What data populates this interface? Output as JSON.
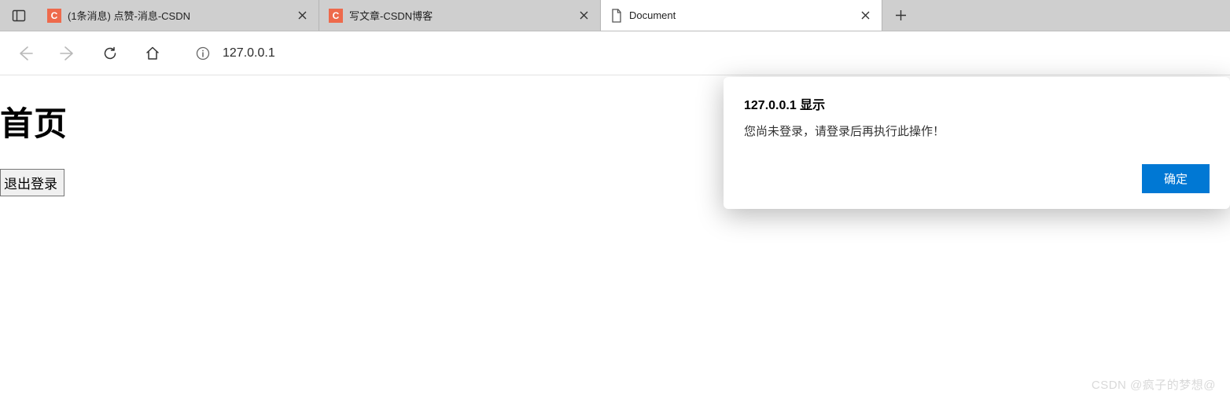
{
  "tabs": [
    {
      "title": "(1条消息) 点赞-消息-CSDN",
      "favicon": "csdn",
      "favicon_letter": "C"
    },
    {
      "title": "写文章-CSDN博客",
      "favicon": "csdn",
      "favicon_letter": "C"
    },
    {
      "title": "Document",
      "favicon": "file"
    }
  ],
  "address_bar": {
    "url": "127.0.0.1"
  },
  "page": {
    "heading": "首页",
    "logout_label": "退出登录"
  },
  "alert": {
    "title": "127.0.0.1 显示",
    "message": "您尚未登录，请登录后再执行此操作！",
    "ok_label": "确定"
  },
  "watermark": "CSDN @疯子的梦想@"
}
